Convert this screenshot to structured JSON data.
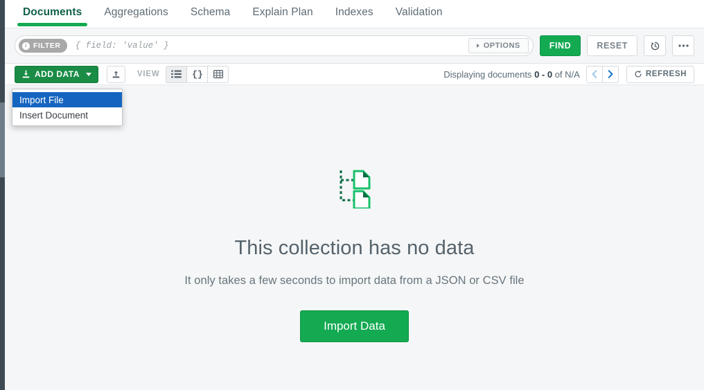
{
  "tabs": [
    {
      "label": "Documents",
      "active": true
    },
    {
      "label": "Aggregations",
      "active": false
    },
    {
      "label": "Schema",
      "active": false
    },
    {
      "label": "Explain Plan",
      "active": false
    },
    {
      "label": "Indexes",
      "active": false
    },
    {
      "label": "Validation",
      "active": false
    }
  ],
  "query_bar": {
    "filter_badge": "FILTER",
    "filter_placeholder": "{ field: 'value' }",
    "filter_value": "",
    "options_label": "OPTIONS",
    "find_label": "FIND",
    "reset_label": "RESET",
    "history_icon": "history-icon",
    "more_icon": "ellipsis-icon"
  },
  "toolbar": {
    "add_data_label": "ADD DATA",
    "add_data_icon": "import-arrow-icon",
    "export_icon": "export-arrow-icon",
    "view_label": "VIEW",
    "view_modes": [
      {
        "name": "list",
        "icon": "list-icon",
        "active": true
      },
      {
        "name": "json",
        "icon": "braces-icon",
        "active": false
      },
      {
        "name": "table",
        "icon": "table-icon",
        "active": false
      }
    ],
    "displaying_prefix": "Displaying documents",
    "displaying_range": "0 - 0",
    "displaying_of": "of",
    "displaying_total": "N/A",
    "prev_icon": "chevron-left-icon",
    "next_icon": "chevron-right-icon",
    "refresh_label": "REFRESH",
    "refresh_icon": "refresh-icon"
  },
  "add_data_menu": {
    "open": true,
    "items": [
      {
        "label": "Import File",
        "highlighted": true
      },
      {
        "label": "Insert Document",
        "highlighted": false
      }
    ]
  },
  "empty_state": {
    "icon": "documents-tree-icon",
    "title": "This collection has no data",
    "subtitle": "It only takes a few seconds to import data from a JSON or CSV file",
    "button_label": "Import Data"
  },
  "colors": {
    "brand_green": "#13aa52",
    "dark_green": "#116149",
    "menu_highlight_blue": "#1565c0",
    "next_page_blue": "#1a73c7",
    "prev_page_blue": "#9ec6e8",
    "stage_bg": "#f5f6f7",
    "rail_dark": "#3d4a54",
    "rail_thumb": "#6f7d89"
  }
}
